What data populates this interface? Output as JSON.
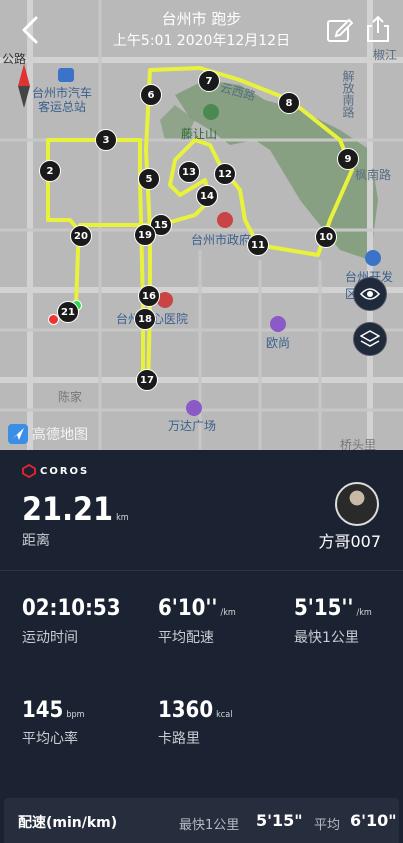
{
  "header": {
    "title": "台州市 跑步",
    "subtitle": "上午5:01 2020年12月12日"
  },
  "map": {
    "labels": {
      "gonglu": "公路",
      "bus_station": "台州市汽车客运总站",
      "bus_station_l1": "台州市汽车",
      "bus_station_l2": "客运总站",
      "yunxi_road": "云西路",
      "jiefang_road": "解放南路",
      "fengnan_road": "枫南路",
      "lianshu": "椒江",
      "xieshan": "藤让山",
      "gov": "台州市政府",
      "kaifa": "台州开发区西街",
      "hospital": "台州中心医院",
      "ousheng": "欧尚",
      "chenjia": "陈家",
      "wanda": "万达广场",
      "qiaotouli": "桥头里",
      "amap": "高德地图"
    },
    "markers": [
      "2",
      "3",
      "5",
      "6",
      "7",
      "8",
      "9",
      "10",
      "11",
      "12",
      "13",
      "14",
      "15",
      "16",
      "17",
      "18",
      "19",
      "20",
      "21"
    ]
  },
  "brand": "COROS",
  "user": {
    "name": "方哥007"
  },
  "stats": {
    "distance": {
      "value": "21.21",
      "unit": "km",
      "label": "距离"
    },
    "duration": {
      "value": "02:10:53",
      "label": "运动时间"
    },
    "avg_pace": {
      "value": "6'10''",
      "unit": "/km",
      "label": "平均配速"
    },
    "fastest_km": {
      "value": "5'15''",
      "unit": "/km",
      "label": "最快1公里"
    },
    "heart_rate": {
      "value": "145",
      "unit": "bpm",
      "label": "平均心率"
    },
    "calories": {
      "value": "1360",
      "unit": "kcal",
      "label": "卡路里"
    }
  },
  "pace_bar": {
    "title": "配速(min/km)",
    "fastest_label": "最快1公里",
    "fastest_value": "5'15\"",
    "avg_label": "平均",
    "avg_value": "6'10\""
  },
  "colors": {
    "route": "#e9f23a",
    "panel_bg": "#1b2231",
    "map_bg": "#b9b9b9",
    "park": "#7f9b78"
  }
}
